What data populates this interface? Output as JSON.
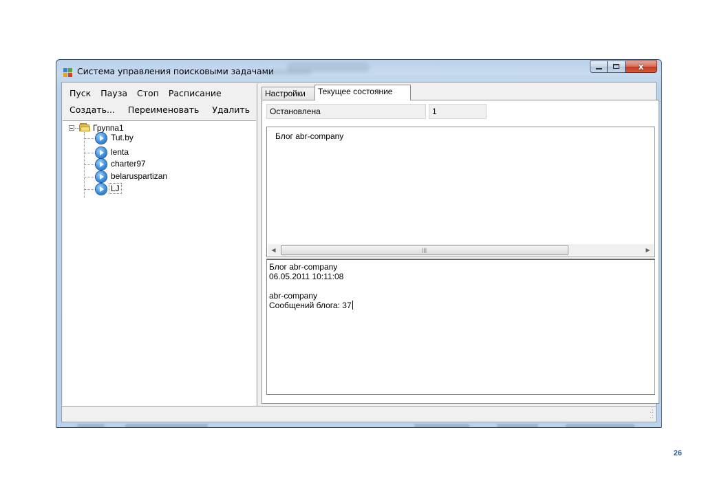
{
  "window": {
    "title": "Система управления поисковыми задачами",
    "buttons": {
      "minimize": "minimize",
      "maximize": "maximize",
      "close": "x"
    }
  },
  "menu": {
    "row1": [
      "Пуск",
      "Пауза",
      "Стоп",
      "Расписание"
    ],
    "row2": [
      "Создать...",
      "Переименовать",
      "Удалить"
    ]
  },
  "tree": {
    "group": "Группа1",
    "items": [
      "Tut.by",
      "lenta",
      "charter97",
      "belaruspartizan",
      "LJ"
    ],
    "selected": "LJ"
  },
  "tabs": [
    "Настройки",
    "Текущее состояние"
  ],
  "active_tab": "Текущее состояние",
  "status": {
    "state": "Остановлена",
    "count": "1"
  },
  "list": {
    "item": "Блог abr-company"
  },
  "details": {
    "lines": [
      "Блог abr-company",
      "06.05.2011 10:11:08",
      "",
      "abr-company",
      "Сообщений блога: 37"
    ]
  },
  "page_number": "26",
  "colors": {
    "window_frame": "#b9d1ea",
    "close_button": "#c2391f",
    "tree_icon": "#3d8fe0"
  }
}
